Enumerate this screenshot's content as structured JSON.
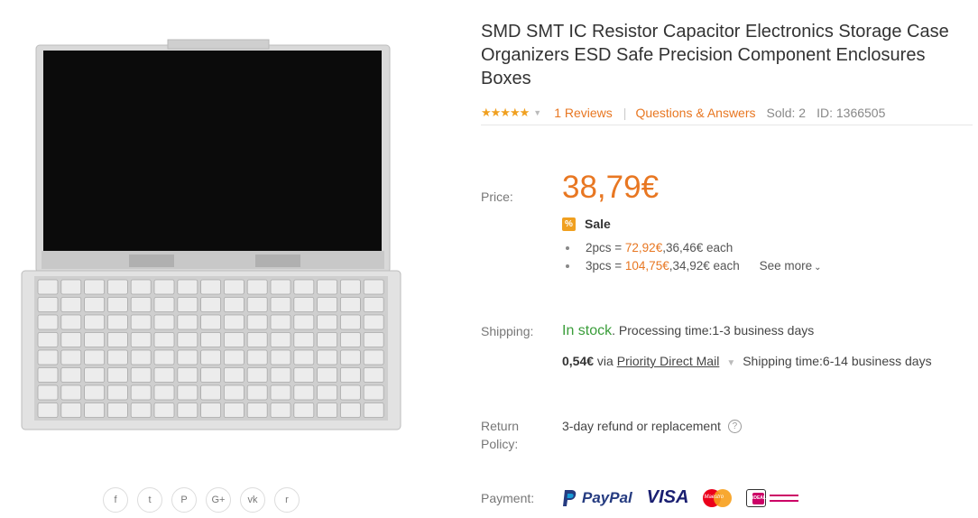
{
  "product": {
    "title": "SMD SMT IC Resistor Capacitor Electronics Storage Case Organizers ESD Safe Precision Component Enclosures Boxes",
    "stars": "★★★★★",
    "reviews": "1 Reviews",
    "qa": "Questions & Answers",
    "sold": "Sold: 2",
    "id": "ID: 1366505"
  },
  "price": {
    "label": "Price:",
    "value": "38,79€",
    "sale_icon": "%",
    "sale_label": "Sale",
    "tiers": [
      {
        "qty": "2pcs = ",
        "total": "72,92€",
        "each": ",36,46€ each"
      },
      {
        "qty": "3pcs = ",
        "total": "104,75€",
        "each": ",34,92€ each"
      }
    ],
    "see_more": "See more"
  },
  "shipping": {
    "label": "Shipping:",
    "stock": "In stock",
    "dot": ".",
    "processing": " Processing time:1-3 business days",
    "cost": "0,54€",
    "via": " via ",
    "method": "Priority Direct Mail",
    "time": "Shipping time:6-14 business days"
  },
  "return": {
    "label_line1": "Return",
    "label_line2": "Policy:",
    "text": "3-day refund or replacement",
    "help_icon": "?"
  },
  "payment": {
    "label": "Payment:",
    "paypal": "PayPal",
    "visa": "VISA",
    "maestro": "Maestro",
    "ideal": "iDEAL"
  },
  "social": [
    {
      "name": "facebook-icon",
      "glyph": "f"
    },
    {
      "name": "twitter-icon",
      "glyph": "t"
    },
    {
      "name": "pinterest-icon",
      "glyph": "P"
    },
    {
      "name": "google-plus-icon",
      "glyph": "G+"
    },
    {
      "name": "vk-icon",
      "glyph": "vk"
    },
    {
      "name": "reddit-icon",
      "glyph": "r"
    }
  ],
  "colors": {
    "accent": "#e87722",
    "stock_green": "#3a9d3a",
    "star": "#f0a020"
  }
}
